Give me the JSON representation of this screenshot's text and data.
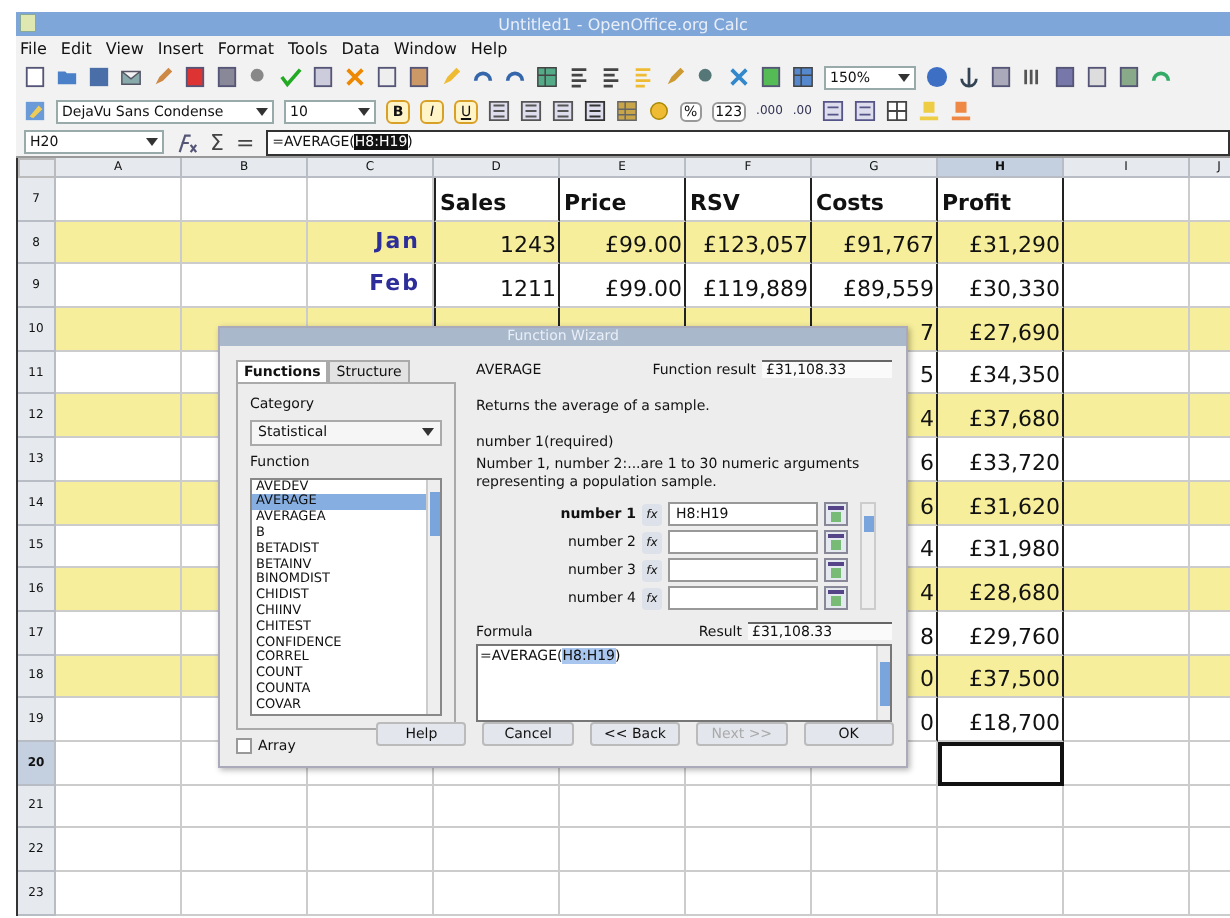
{
  "window": {
    "title": "Untitled1 - OpenOffice.org Calc"
  },
  "menu": [
    "File",
    "Edit",
    "View",
    "Insert",
    "Format",
    "Tools",
    "Data",
    "Window",
    "Help"
  ],
  "toolbar": {
    "zoom": "150%",
    "font_name": "DejaVu Sans Condense",
    "font_size": "10",
    "bold": "B",
    "italic": "I",
    "underline": "U",
    "percent": "%",
    "number": "123",
    "add_decimal": ".000",
    "remove_decimal": ".00"
  },
  "formula_bar": {
    "cell": "H20",
    "sum_symbol": "Σ",
    "equals_symbol": "=",
    "formula_start": "=AVERAGE(",
    "formula_ref": "H8:H19",
    "formula_end": ")"
  },
  "sheet": {
    "columns": [
      {
        "label": "A",
        "selected": false
      },
      {
        "label": "B",
        "selected": false
      },
      {
        "label": "C",
        "selected": false
      },
      {
        "label": "D",
        "selected": false
      },
      {
        "label": "E",
        "selected": false
      },
      {
        "label": "F",
        "selected": false
      },
      {
        "label": "G",
        "selected": false
      },
      {
        "label": "H",
        "selected": true
      },
      {
        "label": "I",
        "selected": false
      },
      {
        "label": "J",
        "selected": false
      }
    ],
    "rows": [
      {
        "number": "7",
        "kind": "header",
        "shaded": false,
        "selected": false,
        "cells": {
          "D": "Sales",
          "E": "Price",
          "F": "RSV",
          "G": "Costs",
          "H": "Profit"
        }
      },
      {
        "number": "8",
        "kind": "data",
        "shaded": true,
        "selected": false,
        "cells": {
          "C": "Jan",
          "D": "1243",
          "E": "£99.00",
          "F": "£123,057",
          "G": "£91,767",
          "H": "£31,290"
        }
      },
      {
        "number": "9",
        "kind": "data",
        "shaded": false,
        "selected": false,
        "cells": {
          "C": "Feb",
          "D": "1211",
          "E": "£99.00",
          "F": "£119,889",
          "G": "£89,559",
          "H": "£30,330"
        }
      },
      {
        "number": "10",
        "kind": "data",
        "shaded": true,
        "selected": false,
        "cells": {
          "G": "7",
          "H": "£27,690"
        }
      },
      {
        "number": "11",
        "kind": "data",
        "shaded": false,
        "selected": false,
        "cells": {
          "G": "5",
          "H": "£34,350"
        }
      },
      {
        "number": "12",
        "kind": "data",
        "shaded": true,
        "selected": false,
        "cells": {
          "G": "4",
          "H": "£37,680"
        }
      },
      {
        "number": "13",
        "kind": "data",
        "shaded": false,
        "selected": false,
        "cells": {
          "G": "6",
          "H": "£33,720"
        }
      },
      {
        "number": "14",
        "kind": "data",
        "shaded": true,
        "selected": false,
        "cells": {
          "G": "6",
          "H": "£31,620"
        }
      },
      {
        "number": "15",
        "kind": "data",
        "shaded": false,
        "selected": false,
        "cells": {
          "G": "4",
          "H": "£31,980"
        }
      },
      {
        "number": "16",
        "kind": "data",
        "shaded": true,
        "selected": false,
        "cells": {
          "G": "4",
          "H": "£28,680"
        }
      },
      {
        "number": "17",
        "kind": "data",
        "shaded": false,
        "selected": false,
        "cells": {
          "G": "8",
          "H": "£29,760"
        }
      },
      {
        "number": "18",
        "kind": "data",
        "shaded": true,
        "selected": false,
        "cells": {
          "G": "0",
          "H": "£37,500"
        }
      },
      {
        "number": "19",
        "kind": "data",
        "shaded": false,
        "selected": false,
        "cells": {
          "G": "0",
          "H": "£18,700"
        }
      },
      {
        "number": "20",
        "kind": "empty",
        "shaded": false,
        "selected": true
      },
      {
        "number": "21",
        "kind": "empty",
        "shaded": false,
        "selected": false
      },
      {
        "number": "22",
        "kind": "empty",
        "shaded": false,
        "selected": false
      },
      {
        "number": "23",
        "kind": "empty",
        "shaded": false,
        "selected": false
      }
    ]
  },
  "dialog": {
    "title": "Function Wizard",
    "tabs": [
      {
        "label": "Functions",
        "selected": true
      },
      {
        "label": "Structure",
        "selected": false
      }
    ],
    "category_label": "Category",
    "category": "Statistical",
    "function_label": "Function",
    "functions": [
      {
        "name": "AVEDEV",
        "selected": false
      },
      {
        "name": "AVERAGE",
        "selected": true
      },
      {
        "name": "AVERAGEA",
        "selected": false
      },
      {
        "name": "B",
        "selected": false
      },
      {
        "name": "BETADIST",
        "selected": false
      },
      {
        "name": "BETAINV",
        "selected": false
      },
      {
        "name": "BINOMDIST",
        "selected": false
      },
      {
        "name": "CHIDIST",
        "selected": false
      },
      {
        "name": "CHIINV",
        "selected": false
      },
      {
        "name": "CHITEST",
        "selected": false
      },
      {
        "name": "CONFIDENCE",
        "selected": false
      },
      {
        "name": "CORREL",
        "selected": false
      },
      {
        "name": "COUNT",
        "selected": false
      },
      {
        "name": "COUNTA",
        "selected": false
      },
      {
        "name": "COVAR",
        "selected": false
      }
    ],
    "array": {
      "label": "Array",
      "checked": false
    },
    "function_name": "AVERAGE",
    "result_label": "Function result",
    "result": "£31,108.33",
    "description": "Returns the average of a sample.",
    "argument_title": "number 1(required)",
    "argument_description": "Number 1, number 2:...are 1 to 30 numeric arguments representing a population sample.",
    "arguments": [
      {
        "label": "number 1",
        "fx": "fx",
        "value": "H8:H19",
        "selected": true
      },
      {
        "label": "number 2",
        "fx": "fx",
        "selected": false
      },
      {
        "label": "number 3",
        "fx": "fx",
        "selected": false
      },
      {
        "label": "number 4",
        "fx": "fx",
        "selected": false
      }
    ],
    "formula_label": "Formula",
    "formula_result_label": "Result",
    "formula_result": "£31,108.33",
    "formula_start": "=AVERAGE(",
    "formula_ref": "H8:H19",
    "formula_end": ")",
    "buttons": [
      {
        "label": "Help",
        "disabled": false
      },
      {
        "label": "Cancel",
        "disabled": false
      },
      {
        "label": "<< Back",
        "disabled": false
      },
      {
        "label": "Next >>",
        "disabled": true
      },
      {
        "label": "OK",
        "disabled": false
      }
    ]
  }
}
